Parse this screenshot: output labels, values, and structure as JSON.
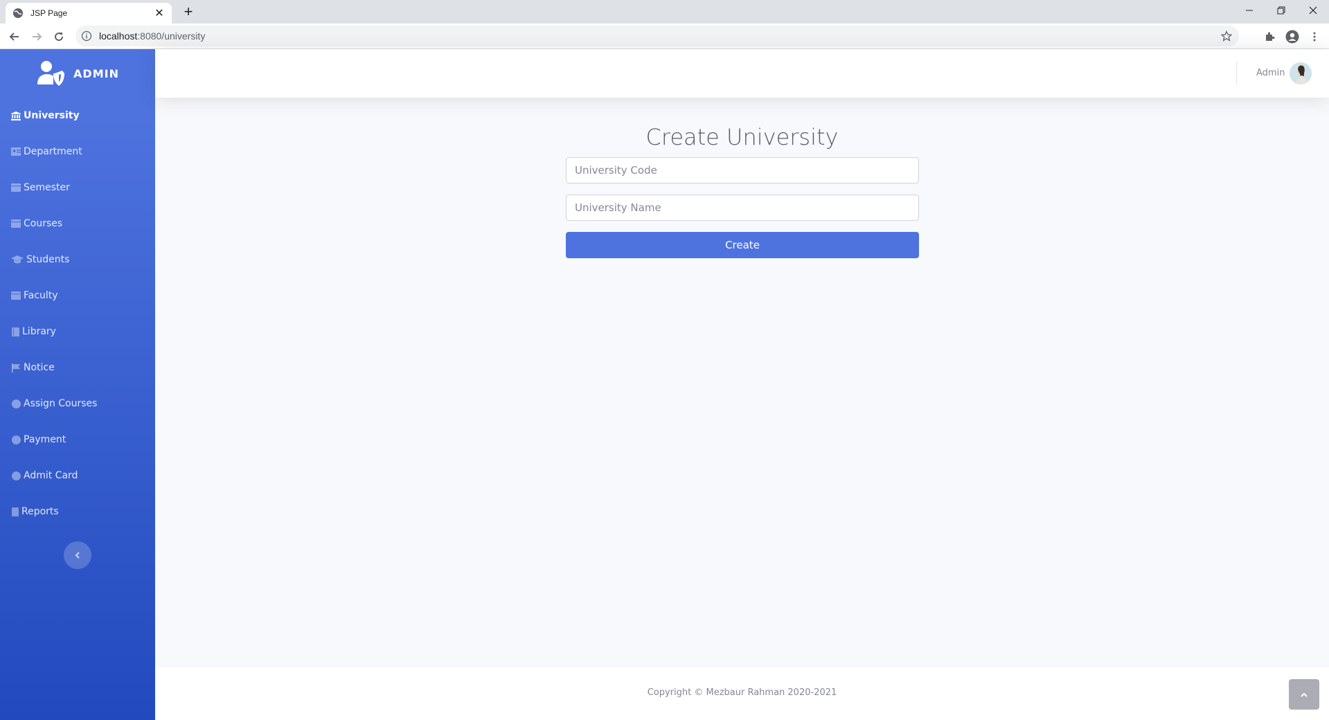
{
  "browser": {
    "tab_title": "JSP Page",
    "url_host": "localhost",
    "url_path": ":8080/university"
  },
  "sidebar": {
    "brand": "ADMIN",
    "items": [
      {
        "label": "University",
        "icon": "university-icon",
        "active": true
      },
      {
        "label": "Department",
        "icon": "id-card-icon"
      },
      {
        "label": "Semester",
        "icon": "calendar-icon"
      },
      {
        "label": "Courses",
        "icon": "calendar-icon"
      },
      {
        "label": "Students",
        "icon": "graduation-cap-icon"
      },
      {
        "label": "Faculty",
        "icon": "calendar-icon"
      },
      {
        "label": "Library",
        "icon": "book-icon"
      },
      {
        "label": "Notice",
        "icon": "flag-icon"
      },
      {
        "label": "Assign Courses",
        "icon": "circle-icon"
      },
      {
        "label": "Payment",
        "icon": "circle-icon"
      },
      {
        "label": "Admit Card",
        "icon": "circle-icon"
      },
      {
        "label": "Reports",
        "icon": "file-icon"
      }
    ]
  },
  "topbar": {
    "user_name": "Admin"
  },
  "form": {
    "title": "Create University",
    "code_placeholder": "University Code",
    "name_placeholder": "University Name",
    "submit_label": "Create"
  },
  "footer": {
    "copyright": "Copyright © Mezbaur Rahman 2020-2021"
  },
  "colors": {
    "primary": "#4e73df",
    "sidebar_gradient_end": "#224abe",
    "background": "#f8f9fc"
  }
}
